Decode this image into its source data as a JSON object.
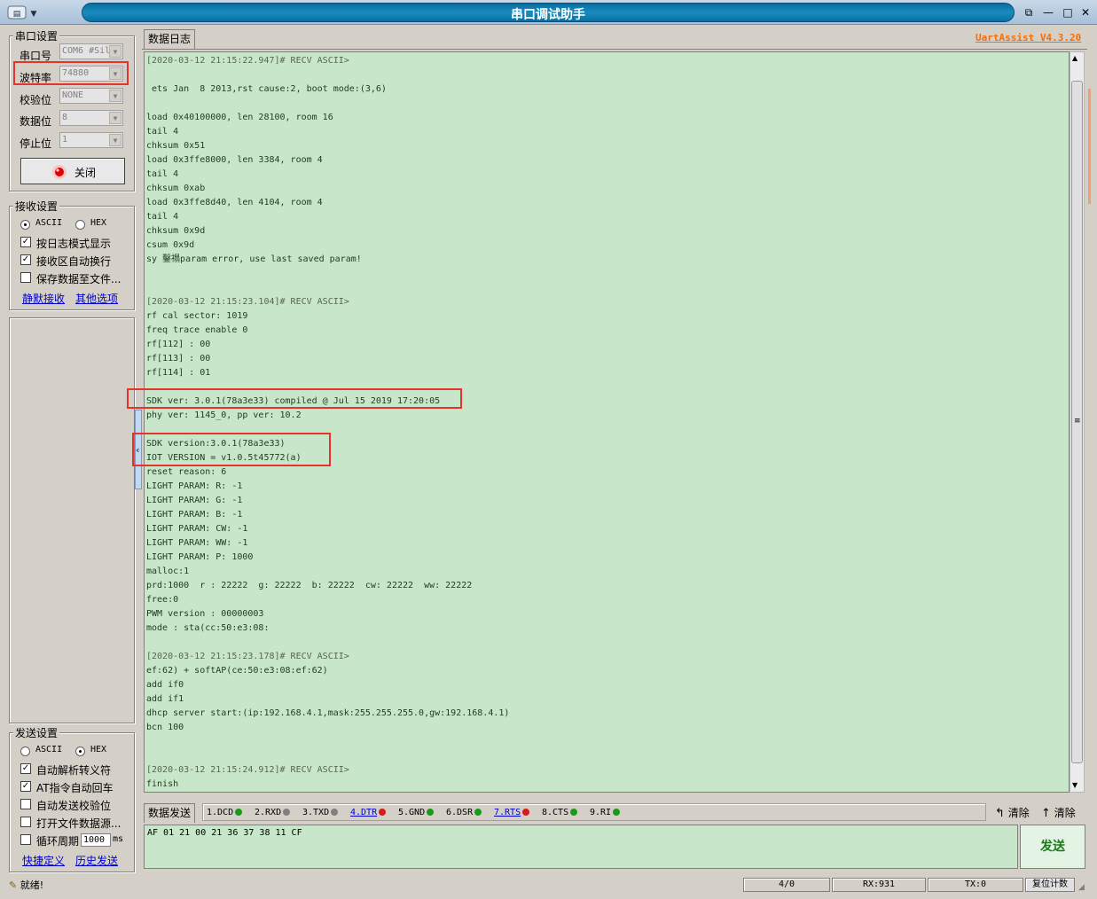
{
  "window": {
    "title": "串口调试助手",
    "version": "UartAssist V4.3.20"
  },
  "serial_settings": {
    "title": "串口设置",
    "port_label": "串口号",
    "port_value": "COM6 #Sil",
    "baud_label": "波特率",
    "baud_value": "74880",
    "parity_label": "校验位",
    "parity_value": "NONE",
    "databits_label": "数据位",
    "databits_value": "8",
    "stopbits_label": "停止位",
    "stopbits_value": "1",
    "close_button": "关闭"
  },
  "recv_settings": {
    "title": "接收设置",
    "ascii": "ASCII",
    "hex": "HEX",
    "log_mode": "按日志模式显示",
    "auto_wrap": "接收区自动换行",
    "save_to_file": "保存数据至文件...",
    "silent_recv": "静默接收",
    "other_options": "其他选项"
  },
  "send_settings": {
    "title": "发送设置",
    "ascii": "ASCII",
    "hex": "HEX",
    "auto_escape": "自动解析转义符",
    "at_auto_crlf": "AT指令自动回车",
    "auto_checksum": "自动发送校验位",
    "open_file_source": "打开文件数据源...",
    "loop_period": "循环周期",
    "loop_value": "1000",
    "loop_unit": "ms",
    "shortcut_def": "快捷定义",
    "history_send": "历史发送"
  },
  "tabs": {
    "log": "数据日志",
    "send": "数据发送"
  },
  "log_lines": [
    "[2020-03-12 21:15:22.947]# RECV ASCII>",
    "",
    " ets Jan  8 2013,rst cause:2, boot mode:(3,6)",
    "",
    "load 0x40100000, len 28100, room 16",
    "tail 4",
    "chksum 0x51",
    "load 0x3ffe8000, len 3384, room 4",
    "tail 4",
    "chksum 0xab",
    "load 0x3ffe8d40, len 4104, room 4",
    "tail 4",
    "chksum 0x9d",
    "csum 0x9d",
    "sy 鑿禢param error, use last saved param!",
    "",
    "",
    "[2020-03-12 21:15:23.104]# RECV ASCII>",
    "rf cal sector: 1019",
    "freq trace enable 0",
    "rf[112] : 00",
    "rf[113] : 00",
    "rf[114] : 01",
    "",
    "SDK ver: 3.0.1(78a3e33) compiled @ Jul 15 2019 17:20:05",
    "phy ver: 1145_0, pp ver: 10.2",
    "",
    "SDK version:3.0.1(78a3e33)",
    "IOT VERSION = v1.0.5t45772(a)",
    "reset reason: 6",
    "LIGHT PARAM: R: -1",
    "LIGHT PARAM: G: -1",
    "LIGHT PARAM: B: -1",
    "LIGHT PARAM: CW: -1",
    "LIGHT PARAM: WW: -1",
    "LIGHT PARAM: P: 1000",
    "malloc:1",
    "prd:1000  r : 22222  g: 22222  b: 22222  cw: 22222  ww: 22222",
    "free:0",
    "PWM version : 00000003",
    "mode : sta(cc:50:e3:08:",
    "",
    "[2020-03-12 21:15:23.178]# RECV ASCII>",
    "ef:62) + softAP(ce:50:e3:08:ef:62)",
    "add if0",
    "add if1",
    "dhcp server start:(ip:192.168.4.1,mask:255.255.255.0,gw:192.168.4.1)",
    "bcn 100",
    "",
    "",
    "[2020-03-12 21:15:24.912]# RECV ASCII>",
    "finish"
  ],
  "signals": {
    "dcd": "1.DCD",
    "rxd": "2.RXD",
    "txd": "3.TXD",
    "dtr": "4.DTR",
    "gnd": "5.GND",
    "dsr": "6.DSR",
    "rts": "7.RTS",
    "cts": "8.CTS",
    "ri": "9.RI"
  },
  "toolbar": {
    "clear1": "清除",
    "clear2": "清除"
  },
  "send": {
    "input_value": "AF 01 21 00 21 36 37 38 11 CF",
    "button": "发送"
  },
  "status": {
    "ready": "就绪!",
    "ratio": "4/0",
    "rx": "RX:931",
    "tx": "TX:0",
    "reset_count": "复位计数"
  },
  "colors": {
    "log_bg": "#c8e6c9",
    "highlight_box": "#e8332a",
    "title_bar": "#1a8cc0",
    "link": "#0000cc",
    "led_green": "#1a9a1a",
    "led_red": "#d81a1a",
    "led_gray": "#808080"
  }
}
